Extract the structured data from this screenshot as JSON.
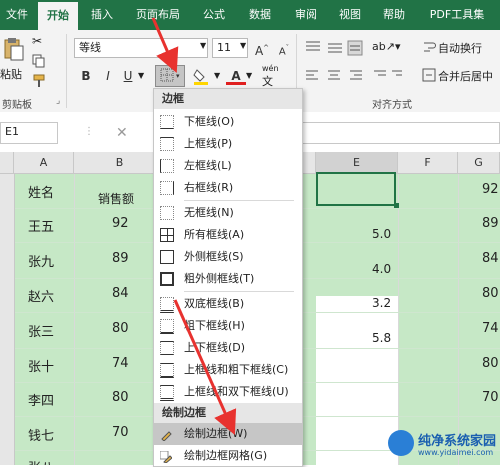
{
  "ribbon": {
    "tabs": [
      "文件",
      "开始",
      "插入",
      "页面布局",
      "公式",
      "数据",
      "审阅",
      "视图",
      "帮助",
      "PDF工具集"
    ],
    "active_tab": "开始",
    "paste_label": "粘贴",
    "clipboard_label": "剪贴板",
    "font_name": "等线",
    "font_size": "11",
    "bold": "B",
    "italic": "I",
    "underline": "U",
    "grow_font": "A",
    "shrink_font": "A",
    "font_color": "A",
    "wen": "wén",
    "align_group_label": "对齐方式",
    "wrap_text": "自动换行",
    "merge_center": "合并后居中"
  },
  "formula_bar": {
    "name_box": "E1",
    "cancel": "✕"
  },
  "sheet": {
    "columns": [
      "A",
      "B",
      "E",
      "F",
      "G"
    ],
    "rows": [
      {
        "name": "姓名",
        "b": "销售额",
        "e": "",
        "g": "92"
      },
      {
        "name": "王五",
        "b": "92",
        "e": "5.0",
        "g": "89"
      },
      {
        "name": "张九",
        "b": "89",
        "e": "4.0",
        "g": "84"
      },
      {
        "name": "赵六",
        "b": "84",
        "e": "3.2",
        "g": "80"
      },
      {
        "name": "张三",
        "b": "80",
        "e": "5.8",
        "g": "74"
      },
      {
        "name": "张十",
        "b": "74",
        "e": "",
        "g": "80"
      },
      {
        "name": "李四",
        "b": "80",
        "e": "",
        "g": "70"
      },
      {
        "name": "钱七",
        "b": "70",
        "e": "",
        "g": ""
      },
      {
        "name": "张八",
        "b": "",
        "e": "",
        "g": ""
      }
    ]
  },
  "border_menu": {
    "section1": "边框",
    "items1": [
      "下框线(O)",
      "上框线(P)",
      "左框线(L)",
      "右框线(R)"
    ],
    "items2": [
      "无框线(N)",
      "所有框线(A)",
      "外侧框线(S)",
      "粗外侧框线(T)"
    ],
    "items3": [
      "双底框线(B)",
      "粗下框线(H)",
      "上下框线(D)",
      "上框线和粗下框线(C)",
      "上框线和双下框线(U)"
    ],
    "section2": "绘制边框",
    "items4": [
      "绘制边框(W)",
      "绘制边框网格(G)"
    ]
  },
  "watermark": {
    "text": "纯净系统家园",
    "url": "www.yidaimei.com"
  },
  "colors": {
    "excel_green": "#217346",
    "cell_fill": "#c6e8c6",
    "arrow_red": "#e8322f"
  }
}
